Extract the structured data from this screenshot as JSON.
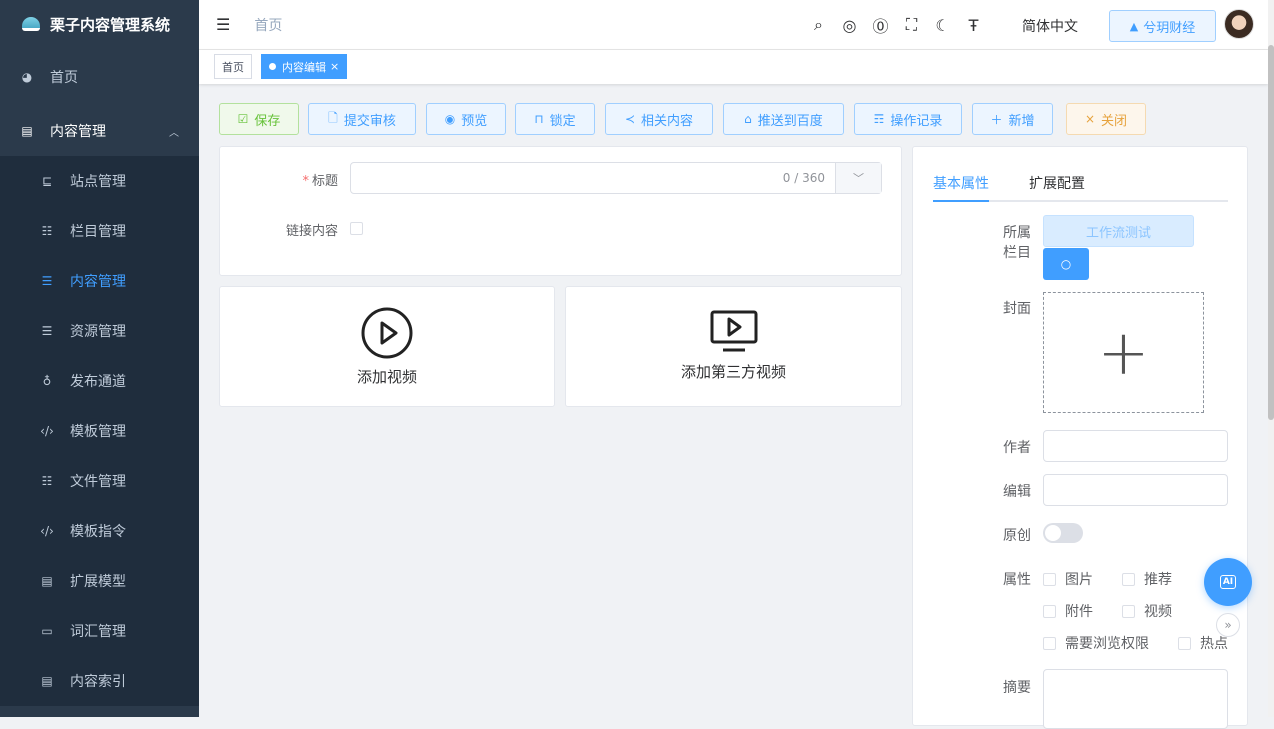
{
  "app": {
    "title": "栗子内容管理系统"
  },
  "sidebar": {
    "home": "首页",
    "group": "内容管理",
    "items": [
      {
        "label": "站点管理",
        "icon": "site-icon",
        "active": false
      },
      {
        "label": "栏目管理",
        "icon": "tree-icon",
        "active": false
      },
      {
        "label": "内容管理",
        "icon": "list-icon",
        "active": true
      },
      {
        "label": "资源管理",
        "icon": "list-icon",
        "active": false
      },
      {
        "label": "发布通道",
        "icon": "thumb-icon",
        "active": false
      },
      {
        "label": "模板管理",
        "icon": "code-icon",
        "active": false
      },
      {
        "label": "文件管理",
        "icon": "tree-icon",
        "active": false
      },
      {
        "label": "模板指令",
        "icon": "code-icon",
        "active": false
      },
      {
        "label": "扩展模型",
        "icon": "doc-edit-icon",
        "active": false
      },
      {
        "label": "词汇管理",
        "icon": "tag-icon",
        "active": false
      },
      {
        "label": "内容索引",
        "icon": "doc-icon",
        "active": false
      }
    ]
  },
  "header": {
    "breadcrumb": "首页",
    "language": "简体中文",
    "tenant_button": "兮玥财经"
  },
  "tags": {
    "home": "首页",
    "active": "内容编辑",
    "close": "×"
  },
  "toolbar": {
    "save": "保存",
    "submit_review": "提交审核",
    "preview": "预览",
    "lock": "锁定",
    "related": "相关内容",
    "push_baidu": "推送到百度",
    "op_log": "操作记录",
    "add": "新增",
    "close": "关闭"
  },
  "form": {
    "title_label": "标题",
    "title_value": "",
    "title_counter": "0 / 360",
    "link_label": "链接内容",
    "link_checked": false
  },
  "video": {
    "add_video": "添加视频",
    "add_third_party": "添加第三方视频"
  },
  "panel": {
    "tabs": [
      "基本属性",
      "扩展配置"
    ],
    "active_tab": 0,
    "catalog_label": "所属栏目",
    "catalog_value": "工作流测试",
    "cover_label": "封面",
    "author_label": "作者",
    "author_value": "",
    "editor_label": "编辑",
    "editor_value": "",
    "original_label": "原创",
    "original_on": false,
    "attr_label": "属性",
    "attributes": [
      "图片",
      "推荐",
      "附件",
      "视频",
      "需要浏览权限",
      "热点"
    ],
    "summary_label": "摘要",
    "ai_button": "AI",
    "expand": "»"
  },
  "colors": {
    "primary": "#409eff",
    "sidebar": "#2b3a4b",
    "success": "#67c23a",
    "warning": "#e6a23c"
  }
}
